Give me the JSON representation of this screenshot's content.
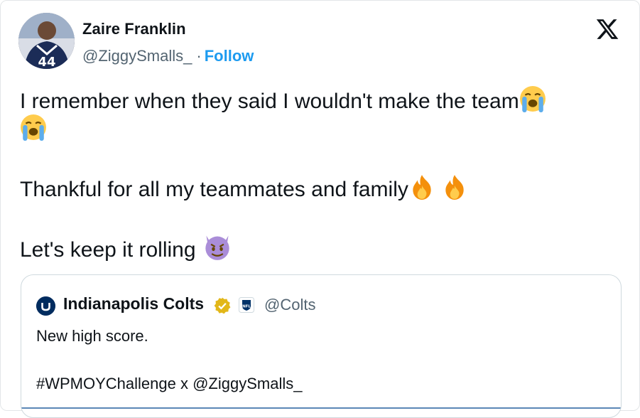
{
  "author": {
    "name": "Zaire Franklin",
    "handle": "@ZiggySmalls_",
    "separator": "·",
    "follow_label": "Follow",
    "avatar_jersey_number": "44"
  },
  "brand_icon": "x-logo-icon",
  "tweet": {
    "line1": "I remember when they said I wouldn't make the team",
    "line3": "Thankful for all my teammates and family",
    "line4": "Let's keep it rolling"
  },
  "quote": {
    "name": "Indianapolis Colts",
    "handle": "@Colts",
    "text1": "New high score.",
    "text2": "#WPMOYChallenge x @ZiggySmalls_",
    "nfl_badge_text": "NFL"
  },
  "colors": {
    "link": "#1d9bf0",
    "text": "#0f1419",
    "muted": "#536471",
    "colts_blue": "#002c5f",
    "verified_gold": "#e2b719"
  },
  "icons": {
    "crying": "loudly-crying-face-icon",
    "fire": "fire-icon",
    "devil": "smiling-face-with-horns-icon",
    "verified": "verified-badge-icon",
    "nfl": "nfl-shield-icon"
  }
}
